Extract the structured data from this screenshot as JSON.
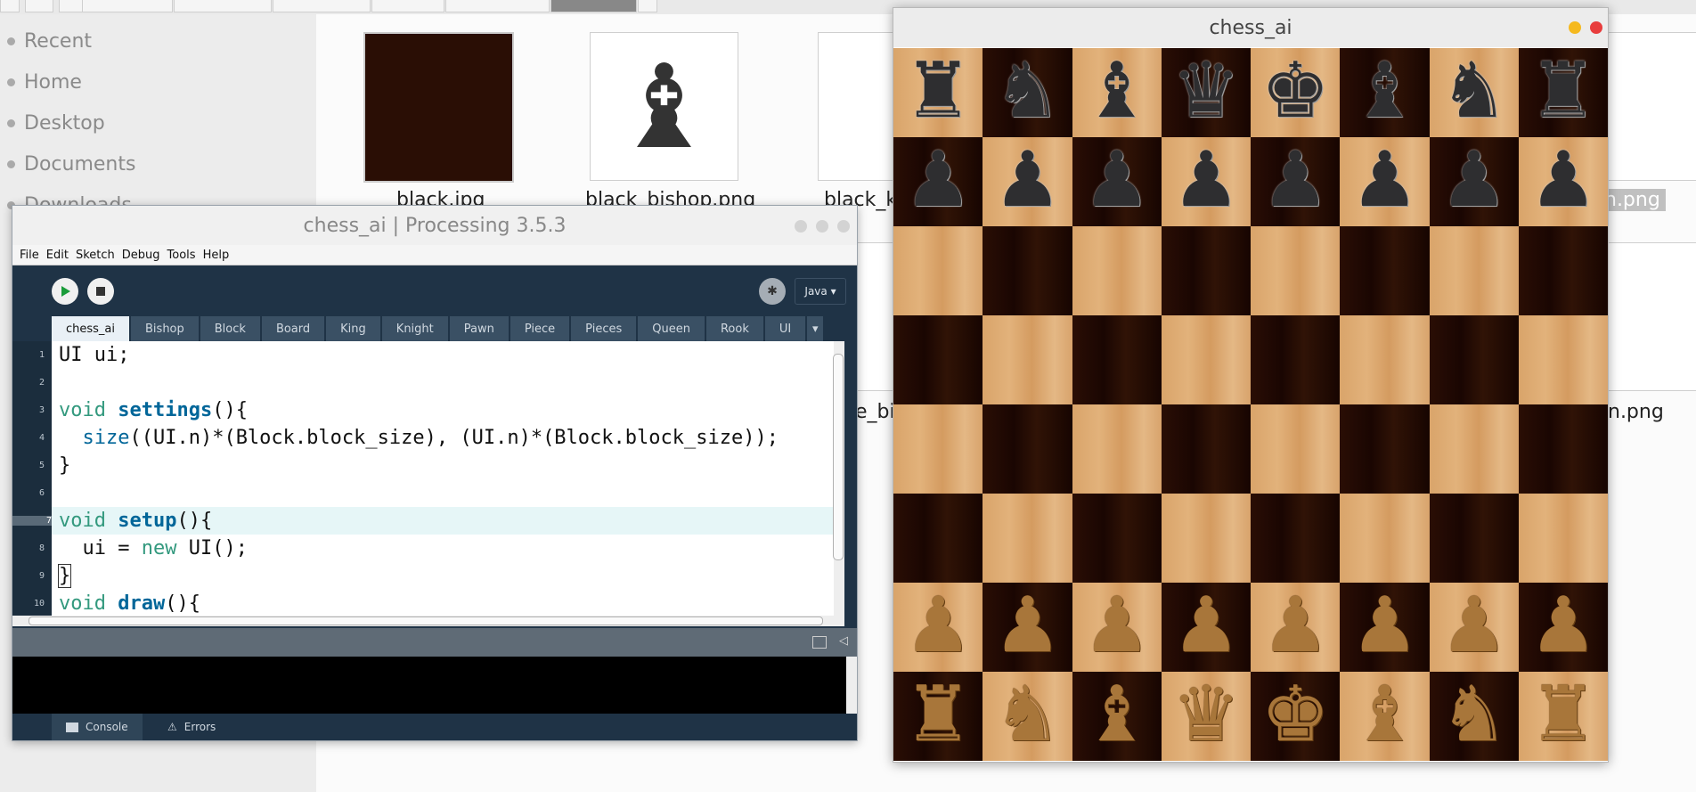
{
  "file_manager": {
    "sidebar": [
      "Recent",
      "Home",
      "Desktop",
      "Documents",
      "Downloads"
    ],
    "files_row1": [
      "black.jpg",
      "black_bishop.png",
      "black_k",
      "n.png"
    ],
    "files_row2": [
      "e_bis",
      "n.png"
    ]
  },
  "ide": {
    "title": "chess_ai | Processing 3.5.3",
    "menu": [
      "File",
      "Edit",
      "Sketch",
      "Debug",
      "Tools",
      "Help"
    ],
    "mode": "Java ▾",
    "tabs": [
      "chess_ai",
      "Bishop",
      "Block",
      "Board",
      "King",
      "Knight",
      "Pawn",
      "Piece",
      "Pieces",
      "Queen",
      "Rook",
      "UI",
      "▾"
    ],
    "line_numbers": [
      "1",
      "2",
      "3",
      "4",
      "5",
      "6",
      "7",
      "8",
      "9",
      "10"
    ],
    "code": {
      "l1": "UI ui;",
      "l3_kw": "void ",
      "l3_fn": "settings",
      "l3_rest": "(){",
      "l4_fn": "size",
      "l4_rest": "((UI.n)*(Block.block_size), (UI.n)*(Block.block_size));",
      "l5": "}",
      "l7_kw": "void ",
      "l7_fn": "setup",
      "l7_rest": "(){",
      "l8_a": "  ui = ",
      "l8_kw": "new",
      "l8_b": " UI();",
      "l9": "}",
      "l10_kw": "void ",
      "l10_fn": "draw",
      "l10_rest": "(){"
    },
    "console_tabs": [
      "Console",
      "Errors"
    ]
  },
  "chess": {
    "title": "chess_ai",
    "ranks": [
      [
        "♜",
        "♞",
        "♝",
        "♛",
        "♚",
        "♝",
        "♞",
        "♜"
      ],
      [
        "♟",
        "♟",
        "♟",
        "♟",
        "♟",
        "♟",
        "♟",
        "♟"
      ],
      [
        "",
        "",
        "",
        "",
        "",
        "",
        "",
        ""
      ],
      [
        "",
        "",
        "",
        "",
        "",
        "",
        "",
        ""
      ],
      [
        "",
        "",
        "",
        "",
        "",
        "",
        "",
        ""
      ],
      [
        "",
        "",
        "",
        "",
        "",
        "",
        "",
        ""
      ],
      [
        "♟",
        "♟",
        "♟",
        "♟",
        "♟",
        "♟",
        "♟",
        "♟"
      ],
      [
        "♜",
        "♞",
        "♝",
        "♛",
        "♚",
        "♝",
        "♞",
        "♜"
      ]
    ],
    "colors": {
      "minimize": "#f5b91f",
      "close": "#e83d3d"
    }
  }
}
